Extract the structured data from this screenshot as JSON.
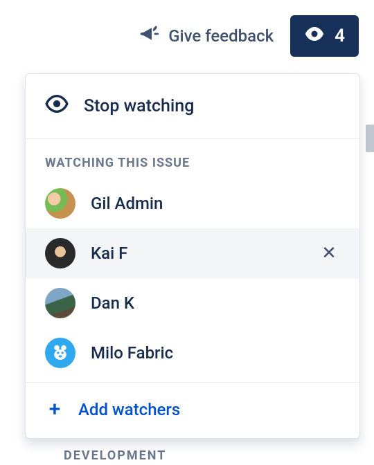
{
  "toolbar": {
    "feedback_label": "Give feedback",
    "watch_count": "4"
  },
  "dropdown": {
    "stop_label": "Stop watching",
    "section_header": "WATCHING THIS ISSUE",
    "watchers": [
      {
        "name": "Gil Admin"
      },
      {
        "name": "Kai F"
      },
      {
        "name": "Dan K"
      },
      {
        "name": "Milo Fabric"
      }
    ],
    "add_label": "Add watchers"
  },
  "background": {
    "hidden_label": "DEVELOPMENT"
  }
}
